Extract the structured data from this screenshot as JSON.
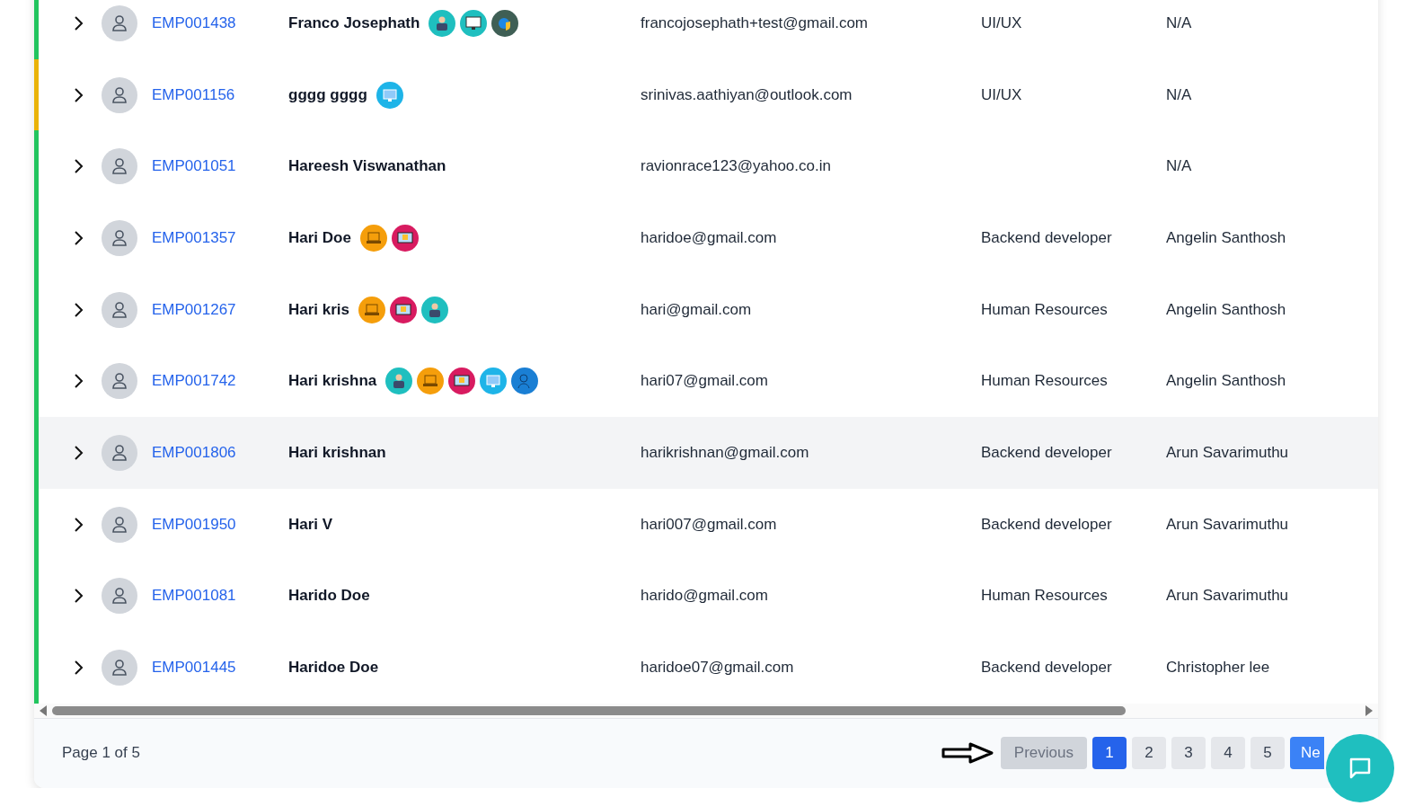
{
  "rows": [
    {
      "id": "EMP001438",
      "name": "Franco Josephath",
      "email": "francojosephath+test@gmail.com",
      "department": "UI/UX",
      "manager": "N/A",
      "color": "#22c55e",
      "selected": false,
      "badges": [
        {
          "kind": "person",
          "color": "#1fbfbf"
        },
        {
          "kind": "monitor",
          "color": "#1fbfbf"
        },
        {
          "kind": "gear",
          "color": "#3f5f55"
        }
      ]
    },
    {
      "id": "EMP001156",
      "name": "gggg gggg",
      "email": "srinivas.aathiyan@outlook.com",
      "department": "UI/UX",
      "manager": "N/A",
      "color": "#eab308",
      "selected": false,
      "badges": [
        {
          "kind": "screen",
          "color": "#1eb4e8"
        }
      ]
    },
    {
      "id": "EMP001051",
      "name": "Hareesh Viswanathan",
      "email": "ravionrace123@yahoo.co.in",
      "manager": "N/A",
      "color": "#22c55e",
      "selected": false,
      "badges": []
    },
    {
      "id": "EMP001357",
      "name": "Hari Doe",
      "email": "haridoe@gmail.com",
      "department": "Backend developer",
      "manager": "Angelin Santhosh",
      "color": "#22c55e",
      "selected": false,
      "badges": [
        {
          "kind": "laptop",
          "color": "#f59e0b"
        },
        {
          "kind": "tv",
          "color": "#d81b60"
        }
      ]
    },
    {
      "id": "EMP001267",
      "name": "Hari kris",
      "email": "hari@gmail.com",
      "department": "Human Resources",
      "manager": "Angelin Santhosh",
      "color": "#22c55e",
      "selected": false,
      "badges": [
        {
          "kind": "laptop",
          "color": "#f59e0b"
        },
        {
          "kind": "tv",
          "color": "#d81b60"
        },
        {
          "kind": "person",
          "color": "#1fbfbf"
        }
      ]
    },
    {
      "id": "EMP001742",
      "name": "Hari krishna",
      "email": "hari07@gmail.com",
      "department": "Human Resources",
      "manager": "Angelin Santhosh",
      "color": "#22c55e",
      "selected": false,
      "badges": [
        {
          "kind": "person",
          "color": "#1fbfbf"
        },
        {
          "kind": "laptop",
          "color": "#f59e0b"
        },
        {
          "kind": "tv",
          "color": "#d81b60"
        },
        {
          "kind": "screen",
          "color": "#1eb4e8"
        },
        {
          "kind": "support",
          "color": "#1a7fd4"
        }
      ]
    },
    {
      "id": "EMP001806",
      "name": "Hari krishnan",
      "email": "harikrishnan@gmail.com",
      "department": "Backend developer",
      "manager": "Arun Savarimuthu",
      "color": "#22c55e",
      "selected": true,
      "badges": []
    },
    {
      "id": "EMP001950",
      "name": "Hari V",
      "email": "hari007@gmail.com",
      "department": "Backend developer",
      "manager": "Arun Savarimuthu",
      "color": "#22c55e",
      "selected": false,
      "badges": []
    },
    {
      "id": "EMP001081",
      "name": "Harido Doe",
      "email": "harido@gmail.com",
      "department": "Human Resources",
      "manager": "Arun Savarimuthu",
      "color": "#22c55e",
      "selected": false,
      "badges": []
    },
    {
      "id": "EMP001445",
      "name": "Haridoe Doe",
      "email": "haridoe07@gmail.com",
      "department": "Backend developer",
      "manager": "Christopher lee",
      "color": "#22c55e",
      "selected": false,
      "badges": []
    }
  ],
  "footer": {
    "page_info": "Page 1 of 5",
    "previous": {
      "label": "Previous",
      "disabled": true
    },
    "pages": [
      {
        "label": "1",
        "selected": true
      },
      {
        "label": "2",
        "selected": false
      },
      {
        "label": "3",
        "selected": false
      },
      {
        "label": "4",
        "selected": false
      },
      {
        "label": "5",
        "selected": false
      }
    ],
    "next": {
      "label": "Ne",
      "disabled": false
    }
  }
}
